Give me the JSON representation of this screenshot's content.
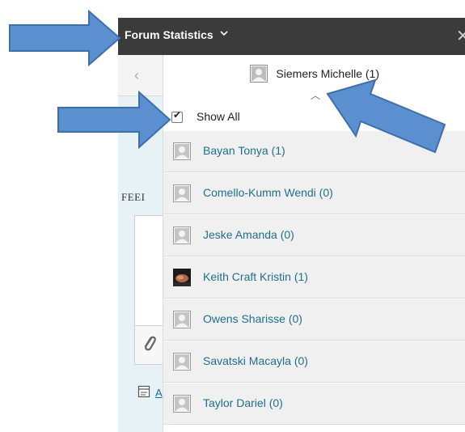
{
  "header": {
    "title": "Forum Statistics",
    "chevron_icon": "chevron-down-icon",
    "close_icon": "close-icon"
  },
  "left_panel": {
    "back_icon": "chevron-left-icon",
    "section_label": "FEEI",
    "attach_icon": "paperclip-icon",
    "doc_icon": "document-icon",
    "link_text": "A"
  },
  "dropdown": {
    "selected_user": "Siemers Michelle (1)",
    "collapse_icon": "chevron-up-icon",
    "show_all": {
      "label": "Show All",
      "checked": true
    },
    "users": [
      {
        "name": "Bayan Tonya (1)",
        "avatar": "default-avatar"
      },
      {
        "name": "Comello-Kumm Wendi (0)",
        "avatar": "default-avatar"
      },
      {
        "name": "Jeske Amanda (0)",
        "avatar": "default-avatar"
      },
      {
        "name": "Keith Craft Kristin (1)",
        "avatar": "photo-avatar"
      },
      {
        "name": "Owens Sharisse (0)",
        "avatar": "default-avatar"
      },
      {
        "name": "Savatski Macayla (0)",
        "avatar": "default-avatar"
      },
      {
        "name": "Taylor Dariel (0)",
        "avatar": "default-avatar"
      }
    ]
  },
  "colors": {
    "header_bg": "#3b3b3b",
    "link": "#1f6f8b",
    "arrow_fill": "#5b8fd0",
    "arrow_stroke": "#3d6fa8"
  }
}
